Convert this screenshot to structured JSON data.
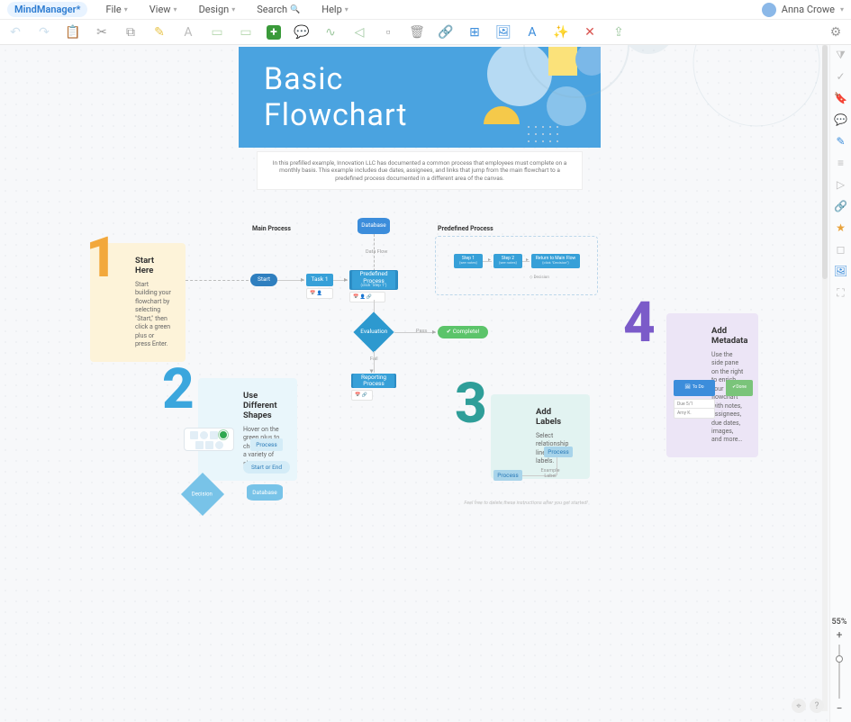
{
  "app": {
    "logo": "MindManager*"
  },
  "menu": {
    "file": "File",
    "view": "View",
    "design": "Design",
    "search": "Search",
    "help": "Help"
  },
  "user": {
    "name": "Anna Crowe"
  },
  "banner": {
    "line1": "Basic",
    "line2": "Flowchart"
  },
  "intro": "In this prefilled example, Innovation LLC has documented a common process that employees must complete on a monthly basis. This example includes due dates, assignees, and links that jump from the main flowchart to a predefined process documented in a different area of the canvas.",
  "sections": {
    "main": "Main Process",
    "predef": "Predefined Process",
    "dataflow": "Data Flow"
  },
  "cards": {
    "c1": {
      "title": "Start Here",
      "body": "Start building your flowchart by selecting \"Start,\" then click a green plus or press Enter."
    },
    "c2": {
      "title": "Use Different Shapes",
      "body": "Hover on the green plus to choose from a variety of shapes."
    },
    "c3": {
      "title": "Add Labels",
      "body": "Select relationship lines to add labels."
    },
    "c4": {
      "title": "Add Metadata",
      "body": "Use the side pane on the right to enrich your flowchart with notes, assignees, due dates, images, and more…"
    }
  },
  "flow": {
    "database": "Database",
    "start": "Start",
    "task1": "Task 1",
    "predef": "Predefined Process",
    "predef_sub": "(click \"Step 1\")",
    "eval": "Evaluation",
    "pass": "Pass",
    "fail": "Fail",
    "complete": "Complete!",
    "reporting": "Reporting Process"
  },
  "predef": {
    "step1": "Step 1",
    "step1_sub": "(see notes)",
    "step2": "Step 2",
    "step2_sub": "(see notes)",
    "return": "Return to Main Flow",
    "return_sub": "(click \"Decision\")",
    "decision": "Decision"
  },
  "examples": {
    "process": "Process",
    "startend": "Start or End",
    "decision": "Decision",
    "database": "Database",
    "label": "Example Label"
  },
  "meta": {
    "todo": "To Do",
    "done": "Done"
  },
  "tip": "Feel free to delete these instructions after you get started!",
  "zoom": {
    "level": "55%",
    "plus": "+",
    "minus": "−"
  },
  "metabadges": {
    "a": "Due 5/1",
    "b": "Amy K."
  }
}
